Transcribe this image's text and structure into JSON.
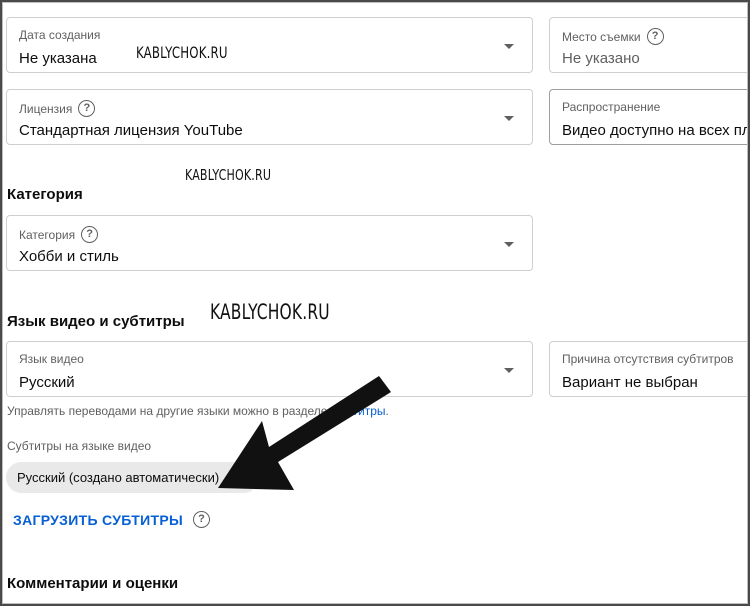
{
  "fields": {
    "recording_date": {
      "label": "Дата создания",
      "value": "Не указана"
    },
    "location": {
      "label": "Место съемки",
      "value": "Не указано"
    },
    "license": {
      "label": "Лицензия",
      "value": "Стандартная лицензия YouTube"
    },
    "distribution": {
      "label": "Распространение",
      "value": "Видео доступно на всех пл"
    },
    "category": {
      "label": "Категория",
      "value": "Хобби и стиль"
    },
    "video_language": {
      "label": "Язык видео",
      "value": "Русский"
    },
    "caption_reason": {
      "label": "Причина отсутствия субтитров",
      "value": "Вариант не выбран"
    }
  },
  "sections": {
    "category_title": "Категория",
    "language_title": "Язык видео и субтитры",
    "comments_title": "Комментарии и оценки"
  },
  "captions": {
    "hint_prefix": "Управлять переводами на другие языки можно в разделе ",
    "hint_link": "Субтитры",
    "hint_suffix": ".",
    "subtitle_label": "Субтитры на языке видео",
    "chip_label": "Русский (создано автоматически)",
    "upload_label": "ЗАГРУЗИТЬ СУБТИТРЫ"
  },
  "watermarks": {
    "w1": "KABLYCHOK.RU",
    "w2": "KABLYCHOK.RU",
    "w3": "KABLYCHOK.RU"
  },
  "icons": {
    "help": "question-circle-icon",
    "dropdown": "caret-down-icon",
    "more": "vertical-dots-icon",
    "annotation": "arrow-annotation"
  },
  "colors": {
    "link": "#065fd4",
    "chip_bg": "#e9e9e9",
    "border": "#cfcfcf"
  }
}
